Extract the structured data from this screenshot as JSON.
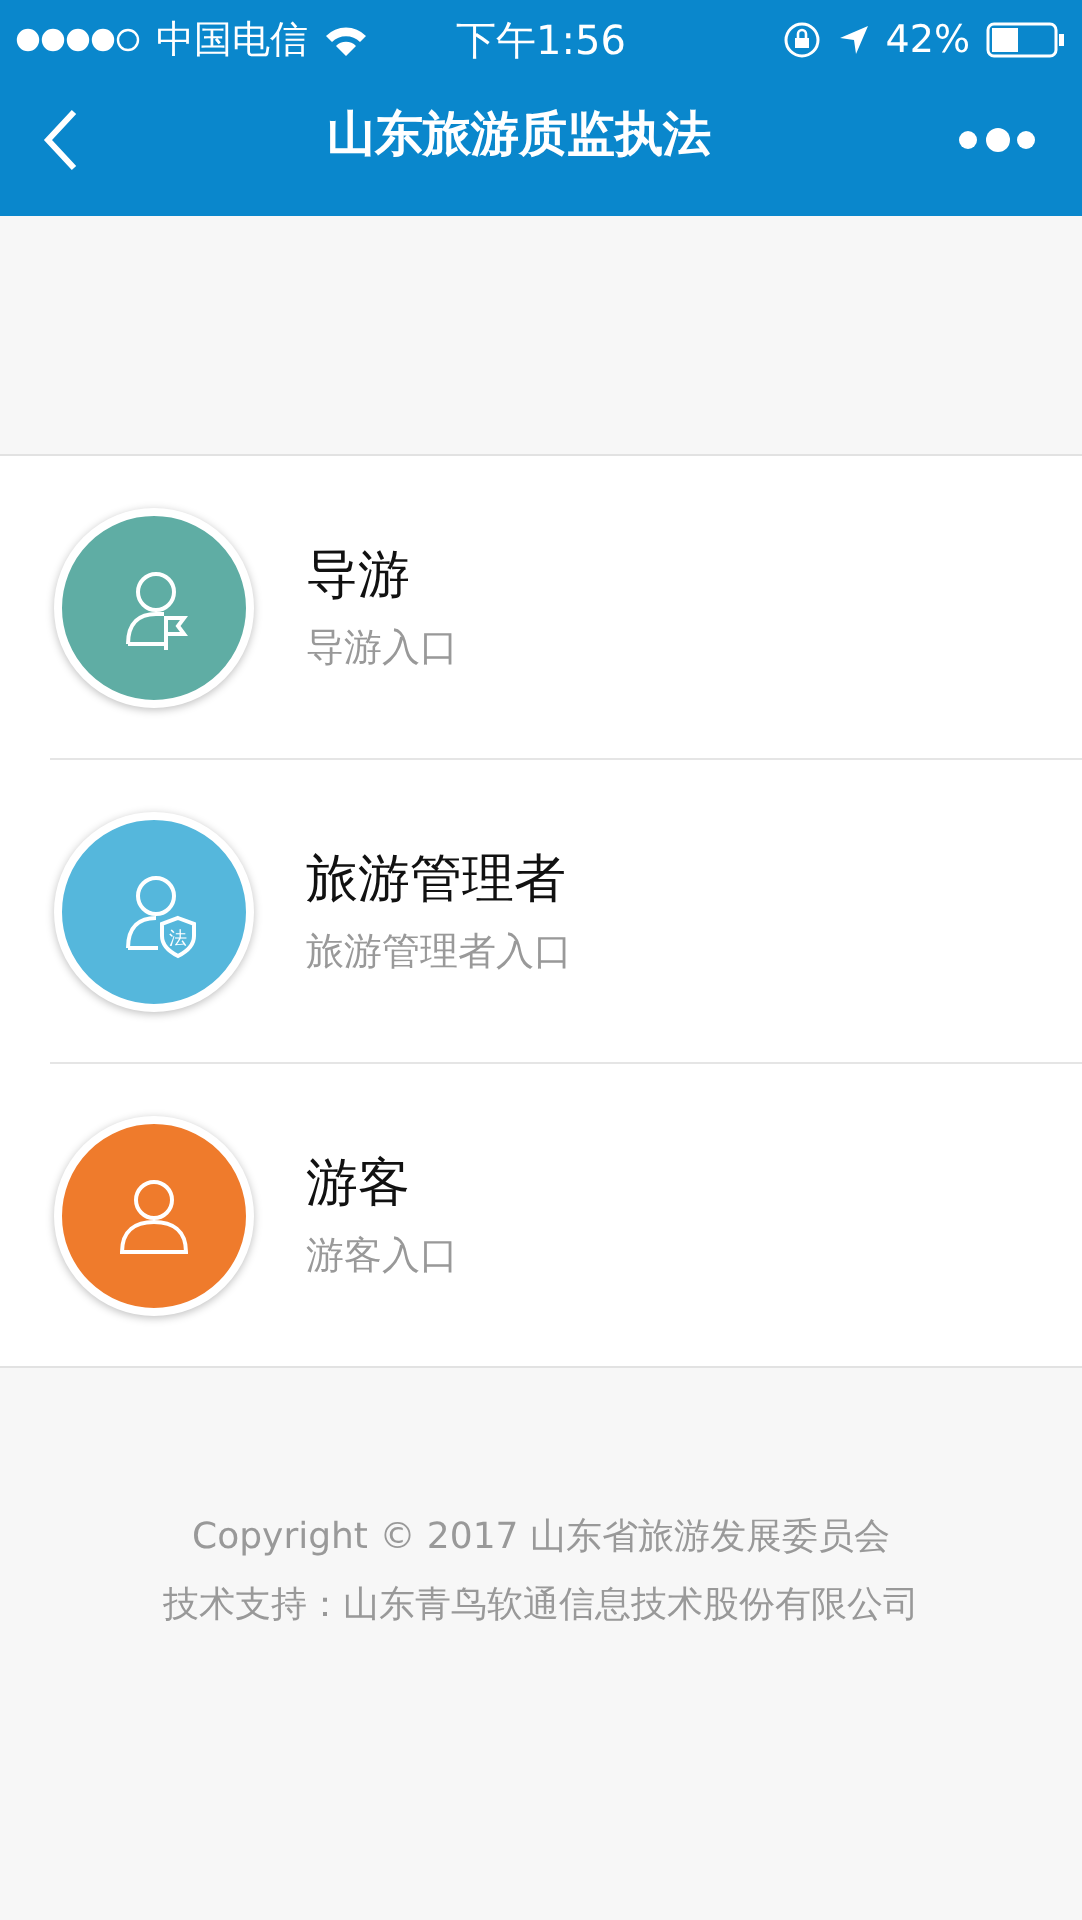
{
  "status_bar": {
    "carrier": "中国电信",
    "time": "下午1:56",
    "battery": "42%"
  },
  "nav_bar": {
    "title": "山东旅游质监执法"
  },
  "entries": [
    {
      "kind": "flag",
      "title": "导游",
      "subtitle": "导游入口",
      "color": "#5fada4"
    },
    {
      "kind": "shield",
      "title": "旅游管理者",
      "subtitle": "旅游管理者入口",
      "color": "#55b7dc",
      "badge": "法"
    },
    {
      "kind": "plain",
      "title": "游客",
      "subtitle": "游客入口",
      "color": "#ef7b2c"
    }
  ],
  "footer": [
    "Copyright © 2017 山东省旅游发展委员会",
    "技术支持：山东青鸟软通信息技术股份有限公司"
  ]
}
